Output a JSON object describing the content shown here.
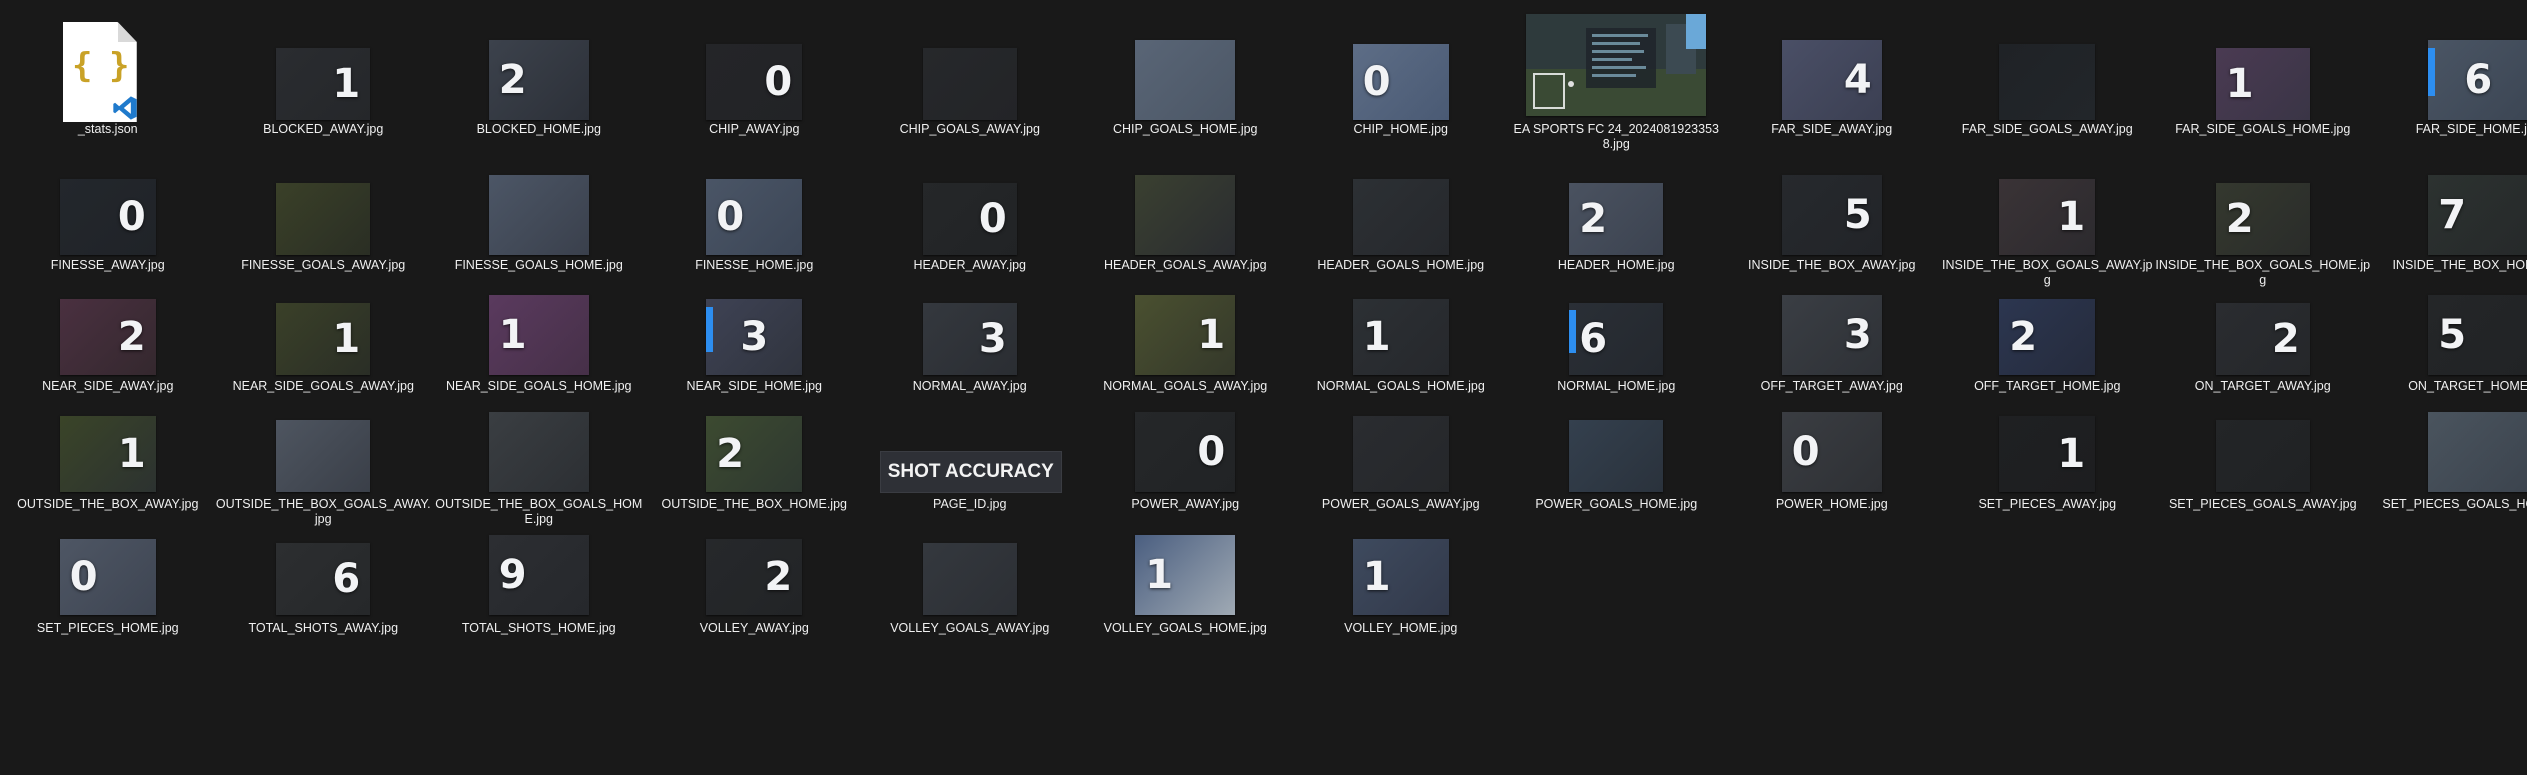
{
  "files": [
    {
      "name": "_stats.json",
      "type": "json",
      "icon": "json-file-icon"
    },
    {
      "name": "BLOCKED_AWAY.jpg",
      "value": "1",
      "colors": [
        "#2a2c30",
        "#25272a"
      ],
      "align": "right"
    },
    {
      "name": "BLOCKED_HOME.jpg",
      "value": "2",
      "colors": [
        "#3c424c",
        "#2c3038"
      ],
      "align": "left"
    },
    {
      "name": "CHIP_AWAY.jpg",
      "value": "0",
      "colors": [
        "#242528",
        "#222326"
      ],
      "align": "right"
    },
    {
      "name": "CHIP_GOALS_AWAY.jpg",
      "value": "",
      "colors": [
        "#26282b",
        "#232427"
      ]
    },
    {
      "name": "CHIP_GOALS_HOME.jpg",
      "value": "",
      "colors": [
        "#596576",
        "#4c5766"
      ]
    },
    {
      "name": "CHIP_HOME.jpg",
      "value": "0",
      "colors": [
        "#5d6d86",
        "#4a5a74"
      ],
      "align": "left"
    },
    {
      "name": "EA SPORTS FC 24_20240819233538.jpg",
      "type": "screenshot"
    },
    {
      "name": "FAR_SIDE_AWAY.jpg",
      "value": "4",
      "colors": [
        "#4a4f66",
        "#3b3f52"
      ],
      "align": "right"
    },
    {
      "name": "FAR_SIDE_GOALS_AWAY.jpg",
      "value": "",
      "colors": [
        "#1f2226",
        "#22262a"
      ]
    },
    {
      "name": "FAR_SIDE_GOALS_HOME.jpg",
      "value": "1",
      "colors": [
        "#4a3a52",
        "#3a3546"
      ],
      "align": "left"
    },
    {
      "name": "FAR_SIDE_HOME.jpg",
      "value": "6",
      "colors": [
        "#4a5564",
        "#3c4654"
      ],
      "align": "center",
      "bar": true
    },
    {
      "name": "FINESSE_AWAY.jpg",
      "value": "0",
      "colors": [
        "#23272c",
        "#202328"
      ],
      "align": "right"
    },
    {
      "name": "FINESSE_GOALS_AWAY.jpg",
      "value": "",
      "colors": [
        "#3a4028",
        "#2a2e24"
      ]
    },
    {
      "name": "FINESSE_GOALS_HOME.jpg",
      "value": "",
      "colors": [
        "#4c5666",
        "#3a404c"
      ]
    },
    {
      "name": "FINESSE_HOME.jpg",
      "value": "0",
      "colors": [
        "#4a5566",
        "#3c4656"
      ],
      "align": "left"
    },
    {
      "name": "HEADER_AWAY.jpg",
      "value": "0",
      "colors": [
        "#252729",
        "#212325"
      ],
      "align": "right"
    },
    {
      "name": "HEADER_GOALS_AWAY.jpg",
      "value": "",
      "colors": [
        "#3a4030",
        "#2a2c30"
      ]
    },
    {
      "name": "HEADER_GOALS_HOME.jpg",
      "value": "",
      "colors": [
        "#2c3034",
        "#26282c"
      ]
    },
    {
      "name": "HEADER_HOME.jpg",
      "value": "2",
      "colors": [
        "#4a5260",
        "#3c4350"
      ],
      "align": "left"
    },
    {
      "name": "INSIDE_THE_BOX_AWAY.jpg",
      "value": "5",
      "colors": [
        "#26292d",
        "#222428"
      ],
      "align": "right"
    },
    {
      "name": "INSIDE_THE_BOX_GOALS_AWAY.jpg",
      "value": "1",
      "colors": [
        "#3a3336",
        "#2c2a2e"
      ],
      "align": "right"
    },
    {
      "name": "INSIDE_THE_BOX_GOALS_HOME.jpg",
      "value": "2",
      "colors": [
        "#34382e",
        "#2a2c2a"
      ],
      "align": "left"
    },
    {
      "name": "INSIDE_THE_BOX_HOME.jpg",
      "value": "7",
      "colors": [
        "#2c3230",
        "#26292a"
      ],
      "align": "left"
    },
    {
      "name": "NEAR_SIDE_AWAY.jpg",
      "value": "2",
      "colors": [
        "#4a3040",
        "#34282e"
      ],
      "align": "right"
    },
    {
      "name": "NEAR_SIDE_GOALS_AWAY.jpg",
      "value": "1",
      "colors": [
        "#3a4028",
        "#2a2e26"
      ],
      "align": "right"
    },
    {
      "name": "NEAR_SIDE_GOALS_HOME.jpg",
      "value": "1",
      "colors": [
        "#5a3a5e",
        "#463048"
      ],
      "align": "left"
    },
    {
      "name": "NEAR_SIDE_HOME.jpg",
      "value": "3",
      "colors": [
        "#3e4254",
        "#30343e"
      ],
      "align": "center",
      "bar": true
    },
    {
      "name": "NORMAL_AWAY.jpg",
      "value": "3",
      "colors": [
        "#34383e",
        "#2a2d32"
      ],
      "align": "right"
    },
    {
      "name": "NORMAL_GOALS_AWAY.jpg",
      "value": "1",
      "colors": [
        "#4a5030",
        "#34382a"
      ],
      "align": "right"
    },
    {
      "name": "NORMAL_GOALS_HOME.jpg",
      "value": "1",
      "colors": [
        "#2c3034",
        "#26282c"
      ],
      "align": "left"
    },
    {
      "name": "NORMAL_HOME.jpg",
      "value": "6",
      "colors": [
        "#2a2f36",
        "#24282e"
      ],
      "align": "left",
      "bar": true
    },
    {
      "name": "OFF_TARGET_AWAY.jpg",
      "value": "3",
      "colors": [
        "#3a3e44",
        "#2e3136"
      ],
      "align": "right"
    },
    {
      "name": "OFF_TARGET_HOME.jpg",
      "value": "2",
      "colors": [
        "#2c3650",
        "#252b3c"
      ],
      "align": "left"
    },
    {
      "name": "ON_TARGET_AWAY.jpg",
      "value": "2",
      "colors": [
        "#2a2c30",
        "#25272a"
      ],
      "align": "right"
    },
    {
      "name": "ON_TARGET_HOME.jpg",
      "value": "5",
      "colors": [
        "#242628",
        "#212325"
      ],
      "align": "left"
    },
    {
      "name": "OUTSIDE_THE_BOX_AWAY.jpg",
      "value": "1",
      "colors": [
        "#3a4428",
        "#2c3230"
      ],
      "align": "right"
    },
    {
      "name": "OUTSIDE_THE_BOX_GOALS_AWAY.jpg",
      "value": "",
      "colors": [
        "#4e5560",
        "#3a3f48"
      ]
    },
    {
      "name": "OUTSIDE_THE_BOX_GOALS_HOME.jpg",
      "value": "",
      "colors": [
        "#3a3e42",
        "#2c2f33"
      ]
    },
    {
      "name": "OUTSIDE_THE_BOX_HOME.jpg",
      "value": "2",
      "colors": [
        "#3c4a30",
        "#2e3830"
      ],
      "align": "left"
    },
    {
      "name": "PAGE_ID.jpg",
      "type": "page-id",
      "label": "SHOT ACCURACY"
    },
    {
      "name": "POWER_AWAY.jpg",
      "value": "0",
      "colors": [
        "#252729",
        "#212325"
      ],
      "align": "right"
    },
    {
      "name": "POWER_GOALS_AWAY.jpg",
      "value": "",
      "colors": [
        "#2a2c30",
        "#25272a"
      ]
    },
    {
      "name": "POWER_GOALS_HOME.jpg",
      "value": "",
      "colors": [
        "#34404e",
        "#2a323c"
      ]
    },
    {
      "name": "POWER_HOME.jpg",
      "value": "0",
      "colors": [
        "#3a3d42",
        "#2e3034"
      ],
      "align": "left"
    },
    {
      "name": "SET_PIECES_AWAY.jpg",
      "value": "1",
      "colors": [
        "#1f2022",
        "#1d1e20"
      ],
      "align": "right"
    },
    {
      "name": "SET_PIECES_GOALS_AWAY.jpg",
      "value": "",
      "colors": [
        "#232527",
        "#202224"
      ]
    },
    {
      "name": "SET_PIECES_GOALS_HOME.jpg",
      "value": "",
      "colors": [
        "#4a545e",
        "#3c444e"
      ]
    },
    {
      "name": "SET_PIECES_HOME.jpg",
      "value": "0",
      "colors": [
        "#4e5664",
        "#3e4552"
      ],
      "align": "left"
    },
    {
      "name": "TOTAL_SHOTS_AWAY.jpg",
      "value": "6",
      "colors": [
        "#2c2e30",
        "#26282a"
      ],
      "align": "right"
    },
    {
      "name": "TOTAL_SHOTS_HOME.jpg",
      "value": "9",
      "colors": [
        "#2c2e32",
        "#26282c"
      ],
      "align": "left"
    },
    {
      "name": "VOLLEY_AWAY.jpg",
      "value": "2",
      "colors": [
        "#26282b",
        "#222426"
      ],
      "align": "right"
    },
    {
      "name": "VOLLEY_GOALS_AWAY.jpg",
      "value": "",
      "colors": [
        "#34383e",
        "#2c2f34"
      ]
    },
    {
      "name": "VOLLEY_GOALS_HOME.jpg",
      "value": "1",
      "colors": [
        "#4a5e80",
        "#a0aab4"
      ],
      "align": "left"
    },
    {
      "name": "VOLLEY_HOME.jpg",
      "value": "1",
      "colors": [
        "#3e4a5e",
        "#32394a"
      ],
      "align": "left"
    }
  ],
  "theme": {
    "background": "#191919",
    "text": "#f0f0f0",
    "accent": "#2d8ef0"
  }
}
